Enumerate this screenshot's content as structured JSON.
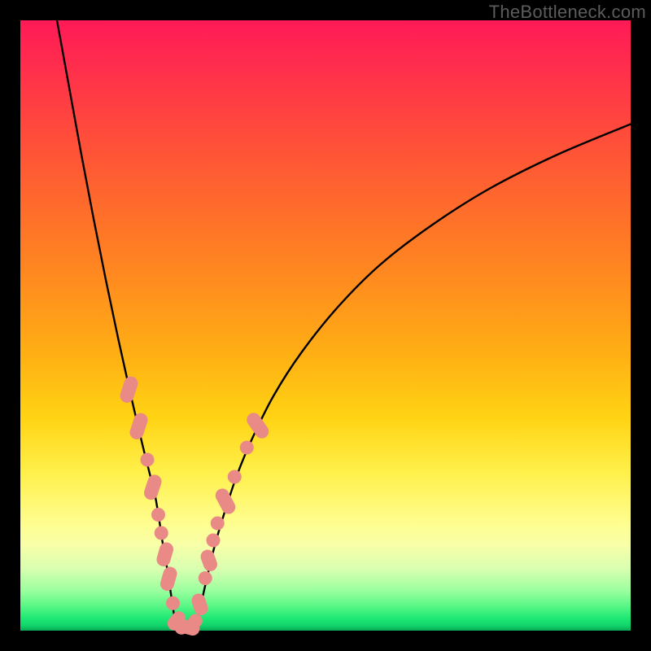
{
  "watermark": "TheBottleneck.com",
  "colors": {
    "curve_stroke": "#000000",
    "marker_fill": "#e98a86",
    "frame_bg": "#000000"
  },
  "chart_data": {
    "type": "line",
    "title": "",
    "xlabel": "",
    "ylabel": "",
    "xlim": [
      0,
      100
    ],
    "ylim": [
      0,
      100
    ],
    "grid": false,
    "series": [
      {
        "name": "left-branch",
        "x": [
          6,
          8,
          10,
          12,
          14,
          16,
          18,
          20,
          21,
          22,
          22.7,
          23.3,
          24,
          24.6,
          25.2,
          25.4
        ],
        "y": [
          100,
          89,
          78,
          67.5,
          57.5,
          48,
          39,
          30.5,
          26.5,
          22.5,
          18.5,
          14.5,
          10.5,
          6.5,
          2.5,
          0.7
        ]
      },
      {
        "name": "floor",
        "x": [
          25.4,
          26.2,
          27.0,
          27.8,
          28.6
        ],
        "y": [
          0.7,
          0.35,
          0.25,
          0.35,
          0.7
        ]
      },
      {
        "name": "right-branch",
        "x": [
          28.6,
          29.4,
          30.2,
          31.0,
          32.0,
          33.5,
          35.5,
          38.0,
          41.5,
          46.0,
          52.0,
          59.0,
          67.5,
          77.0,
          88.0,
          100.0
        ],
        "y": [
          0.7,
          3.5,
          7.0,
          10.5,
          14.5,
          19.5,
          25.5,
          31.5,
          38.5,
          45.5,
          53.0,
          60.0,
          66.5,
          72.5,
          78.0,
          83.0
        ]
      }
    ],
    "markers": [
      {
        "kind": "capsule",
        "x": 17.8,
        "y": 39.5,
        "angle": -72,
        "len": 4.4
      },
      {
        "kind": "capsule",
        "x": 19.4,
        "y": 33.5,
        "angle": -72,
        "len": 4.4
      },
      {
        "kind": "dot",
        "x": 20.8,
        "y": 28.0
      },
      {
        "kind": "capsule",
        "x": 21.7,
        "y": 23.5,
        "angle": -72,
        "len": 4.2
      },
      {
        "kind": "dot",
        "x": 22.6,
        "y": 19.0
      },
      {
        "kind": "dot",
        "x": 23.1,
        "y": 16.0
      },
      {
        "kind": "capsule",
        "x": 23.7,
        "y": 12.5,
        "angle": -74,
        "len": 4.0
      },
      {
        "kind": "capsule",
        "x": 24.3,
        "y": 8.5,
        "angle": -74,
        "len": 4.0
      },
      {
        "kind": "dot",
        "x": 25.0,
        "y": 4.5
      },
      {
        "kind": "capsule",
        "x": 25.6,
        "y": 1.6,
        "angle": -50,
        "len": 3.4
      },
      {
        "kind": "dot",
        "x": 26.4,
        "y": 0.5
      },
      {
        "kind": "capsule",
        "x": 27.6,
        "y": 0.5,
        "angle": 15,
        "len": 3.6
      },
      {
        "kind": "dot",
        "x": 28.7,
        "y": 1.6
      },
      {
        "kind": "capsule",
        "x": 29.4,
        "y": 4.3,
        "angle": 72,
        "len": 3.6
      },
      {
        "kind": "dot",
        "x": 30.3,
        "y": 8.6
      },
      {
        "kind": "capsule",
        "x": 30.9,
        "y": 11.5,
        "angle": 70,
        "len": 3.6
      },
      {
        "kind": "dot",
        "x": 31.6,
        "y": 14.8
      },
      {
        "kind": "dot",
        "x": 32.3,
        "y": 17.6
      },
      {
        "kind": "capsule",
        "x": 33.6,
        "y": 21.2,
        "angle": 62,
        "len": 4.4
      },
      {
        "kind": "dot",
        "x": 35.1,
        "y": 25.2
      },
      {
        "kind": "dot",
        "x": 37.1,
        "y": 30.0
      },
      {
        "kind": "capsule",
        "x": 38.9,
        "y": 33.6,
        "angle": 55,
        "len": 4.6
      }
    ]
  }
}
